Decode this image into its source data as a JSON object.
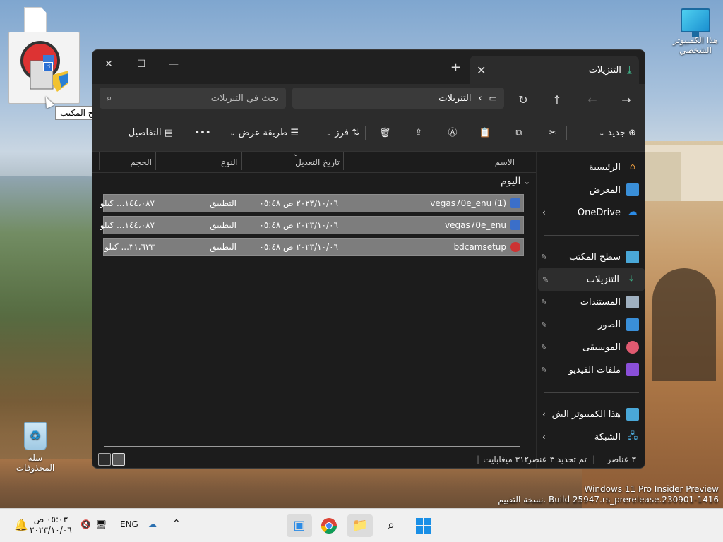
{
  "desktop": {
    "this_pc_label": "هذا الكمبيوتر الشخصي",
    "recycle_bin_label": "سلة المحذوفات",
    "drag_tooltip": "نقل إلى سطح المكتب",
    "drag_tooltip_arrow": "→",
    "drag_badge": "3"
  },
  "window": {
    "tab_title": "التنزيلات",
    "new_tab": "+",
    "tab_close": "✕",
    "minimize": "—",
    "maximize": "☐",
    "close": "✕",
    "path_segment": "التنزيلات",
    "search_placeholder": "بحث في التنزيلات",
    "toolbar": {
      "new_label": "جديد",
      "sort_label": "فرز",
      "view_label": "طريقة عرض",
      "more": "•••",
      "details_label": "التفاصيل"
    },
    "columns": {
      "name": "الاسم",
      "modified": "تاريخ التعديل",
      "type": "النوع",
      "size": "الحجم"
    },
    "group_label": "اليوم",
    "files": [
      {
        "name": "vegas70e_enu (1)",
        "modified": "٢٠٢٣/١٠/٠٦ ص ٠٥:٤٨",
        "type": "التطبيق",
        "size": "١٤٤،٠٨٧... كيلو"
      },
      {
        "name": "vegas70e_enu",
        "modified": "٢٠٢٣/١٠/٠٦ ص ٠٥:٤٨",
        "type": "التطبيق",
        "size": "١٤٤،٠٨٧... كيلو"
      },
      {
        "name": "bdcamsetup",
        "modified": "٢٠٢٣/١٠/٠٦ ص ٠٥:٤٨",
        "type": "التطبيق",
        "size": "٣١،٦٣٣... كيلو"
      }
    ],
    "sidebar": {
      "home": "الرئيسية",
      "gallery": "المعرض",
      "onedrive": "OneDrive",
      "desktop": "سطح المكتب",
      "downloads": "التنزيلات",
      "documents": "المستندات",
      "pictures": "الصور",
      "music": "الموسيقى",
      "videos": "ملفات الفيديو",
      "this_pc": "هذا الكمبيوتر الش",
      "network": "الشبكة"
    },
    "status": {
      "count": "٣ عناصر",
      "selection": "تم تحديد ٣ عنصر",
      "size": "٣١٢ ميغابايت"
    }
  },
  "watermark": {
    "line1": "Windows 11 Pro Insider Preview",
    "line2": "نسخة التقييم. Build 25947.rs_prerelease.230901-1416"
  },
  "taskbar": {
    "lang": "ENG",
    "time": "٠٥:٠٣ ص",
    "date": "٢٠٢٣/١٠/٠٦"
  },
  "colors": {
    "accent": "#3fb68b",
    "selection_row": "#7d7d7d",
    "window_bg": "#1c1c1c"
  }
}
